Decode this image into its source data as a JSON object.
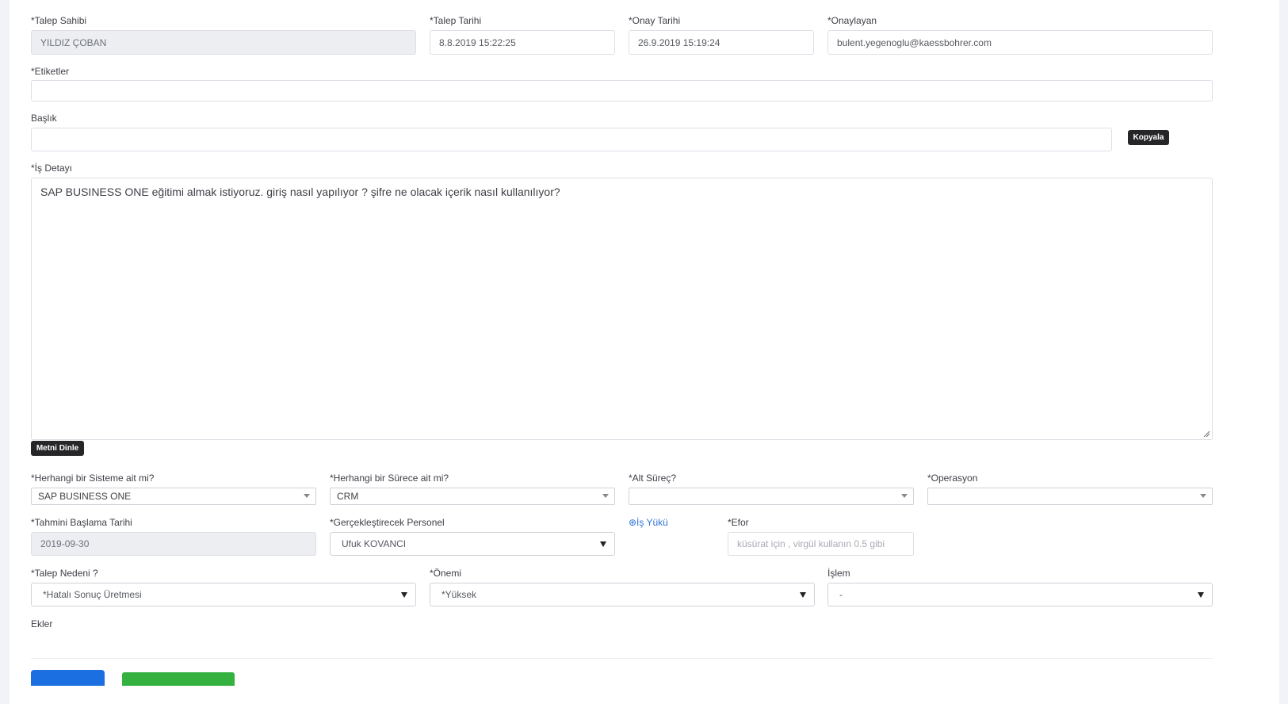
{
  "row1": {
    "talep_sahibi_label": "*Talep Sahibi",
    "talep_sahibi_value": "YILDIZ ÇOBAN",
    "talep_tarihi_label": "*Talep Tarihi",
    "talep_tarihi_value": "8.8.2019 15:22:25",
    "onay_tarihi_label": "*Onay Tarihi",
    "onay_tarihi_value": "26.9.2019 15:19:24",
    "onaylayan_label": "*Onaylayan",
    "onaylayan_value": "bulent.yegenoglu@kaessbohrer.com"
  },
  "etiketler": {
    "label": "*Etiketler",
    "value": ""
  },
  "baslik": {
    "label": "Başlık",
    "value": "",
    "copy_button": "Kopyala"
  },
  "is_detayi": {
    "label": "*İş Detayı",
    "value": "SAP BUSINESS ONE eğitimi almak istiyoruz. giriş nasıl yapılıyor ? şifre ne olacak içerik nasıl kullanılıyor?",
    "listen_button": "Metni Dinle"
  },
  "row_system": {
    "sistem_label": "*Herhangi bir Sisteme ait mi?",
    "sistem_value": "SAP BUSINESS ONE",
    "surec_label": "*Herhangi bir Sürece ait mi?",
    "surec_value": "CRM",
    "alt_surec_label": "*Alt Süreç?",
    "alt_surec_value": "",
    "operasyon_label": "*Operasyon",
    "operasyon_value": ""
  },
  "row_plan": {
    "baslama_label": "*Tahmini Başlama Tarihi",
    "baslama_value": "2019-09-30",
    "personel_label": "*Gerçekleştirecek Personel",
    "personel_value": "Ufuk KOVANCI",
    "is_yuku_link": "⊕İş Yükü",
    "efor_label": "*Efor",
    "efor_placeholder": "küsürat için , virgül kullanın 0.5 gibi"
  },
  "row_reason": {
    "neden_label": "*Talep Nedeni ?",
    "neden_value": "*Hatalı Sonuç Üretmesi",
    "onem_label": "*Önemi",
    "onem_value": "*Yüksek",
    "islem_label": "İşlem",
    "islem_value": "-"
  },
  "ekler": {
    "label": "Ekler"
  },
  "colors": {
    "primary": "#1b6fe0",
    "success": "#34b13f",
    "link": "#2f74d8"
  }
}
